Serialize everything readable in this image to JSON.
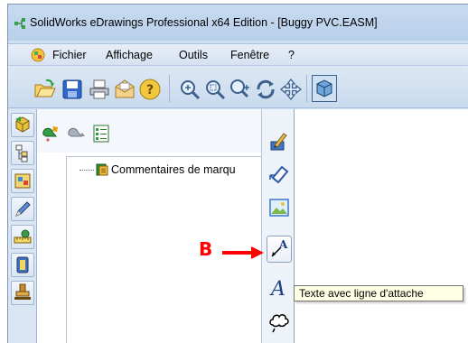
{
  "window": {
    "title": "SolidWorks eDrawings Professional x64 Edition - [Buggy PVC.EASM]"
  },
  "menu": {
    "items": [
      "Fichier",
      "Affichage",
      "Outils",
      "Fenêtre",
      "?"
    ]
  },
  "toolbar": {
    "icons": [
      "open-icon",
      "save-icon",
      "print-icon",
      "send-mail-icon",
      "help-icon",
      "zoom-fit-icon",
      "zoom-area-icon",
      "zoom-icon",
      "rotate-icon",
      "pan-icon",
      "3d-view-icon"
    ]
  },
  "left_tabs": {
    "icons": [
      "components-icon",
      "tree-icon",
      "configurations-icon",
      "markup-pen-icon",
      "measure-icon",
      "animation-icon",
      "stamp-icon"
    ]
  },
  "panel": {
    "tree": {
      "item_label": "Commentaires de marqu"
    }
  },
  "right_toolbar": {
    "icons": [
      "pencil-markup-icon",
      "dimension-icon",
      "picture-icon",
      "text-leader-icon",
      "text-icon",
      "cloud-icon"
    ]
  },
  "tooltip": {
    "text": "Texte avec ligne d'attache"
  },
  "annotation": {
    "label": "B",
    "color": "#ff0000"
  }
}
